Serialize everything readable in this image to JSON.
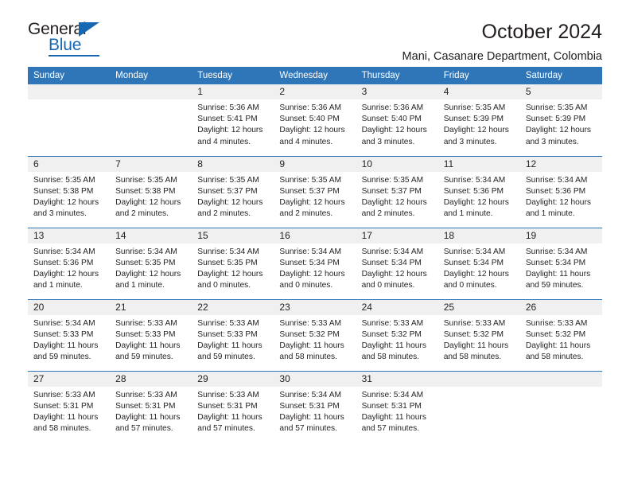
{
  "logo": {
    "primary_text": "General",
    "secondary_text": "Blue",
    "triangle_color": "#1668b3",
    "primary_color": "#231f20",
    "secondary_color": "#1668b3"
  },
  "header": {
    "title": "October 2024",
    "subtitle": "Mani, Casanare Department, Colombia"
  },
  "theme": {
    "header_bar_color": "#2f76b8",
    "day_number_band_color": "#f0f0f0",
    "text_color": "#231f20"
  },
  "calendar": {
    "weekday_headers": [
      "Sunday",
      "Monday",
      "Tuesday",
      "Wednesday",
      "Thursday",
      "Friday",
      "Saturday"
    ],
    "weeks": [
      [
        {
          "day": "",
          "lines": []
        },
        {
          "day": "",
          "lines": []
        },
        {
          "day": "1",
          "lines": [
            "Sunrise: 5:36 AM",
            "Sunset: 5:41 PM",
            "Daylight: 12 hours and 4 minutes."
          ]
        },
        {
          "day": "2",
          "lines": [
            "Sunrise: 5:36 AM",
            "Sunset: 5:40 PM",
            "Daylight: 12 hours and 4 minutes."
          ]
        },
        {
          "day": "3",
          "lines": [
            "Sunrise: 5:36 AM",
            "Sunset: 5:40 PM",
            "Daylight: 12 hours and 3 minutes."
          ]
        },
        {
          "day": "4",
          "lines": [
            "Sunrise: 5:35 AM",
            "Sunset: 5:39 PM",
            "Daylight: 12 hours and 3 minutes."
          ]
        },
        {
          "day": "5",
          "lines": [
            "Sunrise: 5:35 AM",
            "Sunset: 5:39 PM",
            "Daylight: 12 hours and 3 minutes."
          ]
        }
      ],
      [
        {
          "day": "6",
          "lines": [
            "Sunrise: 5:35 AM",
            "Sunset: 5:38 PM",
            "Daylight: 12 hours and 3 minutes."
          ]
        },
        {
          "day": "7",
          "lines": [
            "Sunrise: 5:35 AM",
            "Sunset: 5:38 PM",
            "Daylight: 12 hours and 2 minutes."
          ]
        },
        {
          "day": "8",
          "lines": [
            "Sunrise: 5:35 AM",
            "Sunset: 5:37 PM",
            "Daylight: 12 hours and 2 minutes."
          ]
        },
        {
          "day": "9",
          "lines": [
            "Sunrise: 5:35 AM",
            "Sunset: 5:37 PM",
            "Daylight: 12 hours and 2 minutes."
          ]
        },
        {
          "day": "10",
          "lines": [
            "Sunrise: 5:35 AM",
            "Sunset: 5:37 PM",
            "Daylight: 12 hours and 2 minutes."
          ]
        },
        {
          "day": "11",
          "lines": [
            "Sunrise: 5:34 AM",
            "Sunset: 5:36 PM",
            "Daylight: 12 hours and 1 minute."
          ]
        },
        {
          "day": "12",
          "lines": [
            "Sunrise: 5:34 AM",
            "Sunset: 5:36 PM",
            "Daylight: 12 hours and 1 minute."
          ]
        }
      ],
      [
        {
          "day": "13",
          "lines": [
            "Sunrise: 5:34 AM",
            "Sunset: 5:36 PM",
            "Daylight: 12 hours and 1 minute."
          ]
        },
        {
          "day": "14",
          "lines": [
            "Sunrise: 5:34 AM",
            "Sunset: 5:35 PM",
            "Daylight: 12 hours and 1 minute."
          ]
        },
        {
          "day": "15",
          "lines": [
            "Sunrise: 5:34 AM",
            "Sunset: 5:35 PM",
            "Daylight: 12 hours and 0 minutes."
          ]
        },
        {
          "day": "16",
          "lines": [
            "Sunrise: 5:34 AM",
            "Sunset: 5:34 PM",
            "Daylight: 12 hours and 0 minutes."
          ]
        },
        {
          "day": "17",
          "lines": [
            "Sunrise: 5:34 AM",
            "Sunset: 5:34 PM",
            "Daylight: 12 hours and 0 minutes."
          ]
        },
        {
          "day": "18",
          "lines": [
            "Sunrise: 5:34 AM",
            "Sunset: 5:34 PM",
            "Daylight: 12 hours and 0 minutes."
          ]
        },
        {
          "day": "19",
          "lines": [
            "Sunrise: 5:34 AM",
            "Sunset: 5:34 PM",
            "Daylight: 11 hours and 59 minutes."
          ]
        }
      ],
      [
        {
          "day": "20",
          "lines": [
            "Sunrise: 5:34 AM",
            "Sunset: 5:33 PM",
            "Daylight: 11 hours and 59 minutes."
          ]
        },
        {
          "day": "21",
          "lines": [
            "Sunrise: 5:33 AM",
            "Sunset: 5:33 PM",
            "Daylight: 11 hours and 59 minutes."
          ]
        },
        {
          "day": "22",
          "lines": [
            "Sunrise: 5:33 AM",
            "Sunset: 5:33 PM",
            "Daylight: 11 hours and 59 minutes."
          ]
        },
        {
          "day": "23",
          "lines": [
            "Sunrise: 5:33 AM",
            "Sunset: 5:32 PM",
            "Daylight: 11 hours and 58 minutes."
          ]
        },
        {
          "day": "24",
          "lines": [
            "Sunrise: 5:33 AM",
            "Sunset: 5:32 PM",
            "Daylight: 11 hours and 58 minutes."
          ]
        },
        {
          "day": "25",
          "lines": [
            "Sunrise: 5:33 AM",
            "Sunset: 5:32 PM",
            "Daylight: 11 hours and 58 minutes."
          ]
        },
        {
          "day": "26",
          "lines": [
            "Sunrise: 5:33 AM",
            "Sunset: 5:32 PM",
            "Daylight: 11 hours and 58 minutes."
          ]
        }
      ],
      [
        {
          "day": "27",
          "lines": [
            "Sunrise: 5:33 AM",
            "Sunset: 5:31 PM",
            "Daylight: 11 hours and 58 minutes."
          ]
        },
        {
          "day": "28",
          "lines": [
            "Sunrise: 5:33 AM",
            "Sunset: 5:31 PM",
            "Daylight: 11 hours and 57 minutes."
          ]
        },
        {
          "day": "29",
          "lines": [
            "Sunrise: 5:33 AM",
            "Sunset: 5:31 PM",
            "Daylight: 11 hours and 57 minutes."
          ]
        },
        {
          "day": "30",
          "lines": [
            "Sunrise: 5:34 AM",
            "Sunset: 5:31 PM",
            "Daylight: 11 hours and 57 minutes."
          ]
        },
        {
          "day": "31",
          "lines": [
            "Sunrise: 5:34 AM",
            "Sunset: 5:31 PM",
            "Daylight: 11 hours and 57 minutes."
          ]
        },
        {
          "day": "",
          "lines": []
        },
        {
          "day": "",
          "lines": []
        }
      ]
    ]
  }
}
